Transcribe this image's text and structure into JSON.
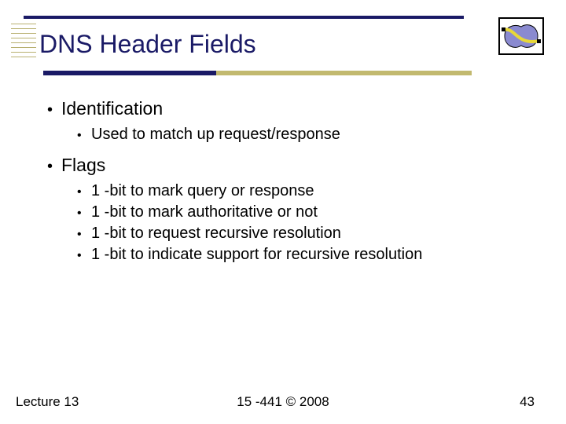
{
  "title": "DNS Header Fields",
  "bullets": {
    "identification": {
      "label": "Identification",
      "sub": [
        "Used to match up request/response"
      ]
    },
    "flags": {
      "label": "Flags",
      "sub": [
        "1 -bit to mark query or response",
        "1 -bit to mark authoritative or not",
        "1 -bit to request recursive resolution",
        "1 -bit to indicate support for recursive resolution"
      ]
    }
  },
  "footer": {
    "left": "Lecture 13",
    "center": "15 -441 ©  2008",
    "right": "43"
  }
}
